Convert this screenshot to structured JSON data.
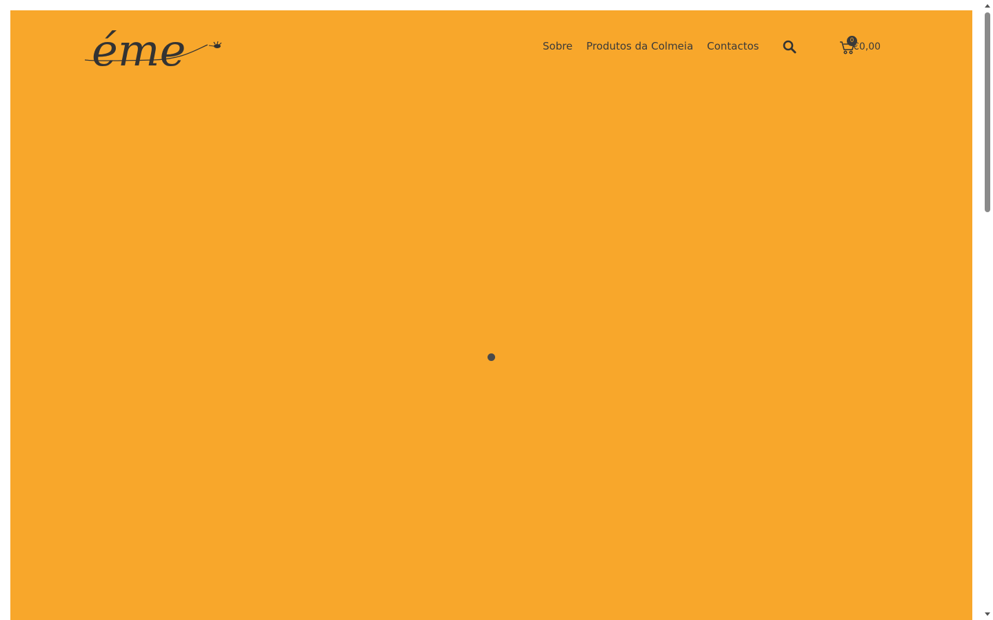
{
  "brand": {
    "logo_text": "éme",
    "logo_icon": "bee-icon",
    "ink_color": "#333333"
  },
  "nav": {
    "items": [
      {
        "label": "Sobre"
      },
      {
        "label": "Produtos da Colmeia"
      },
      {
        "label": "Contactos"
      }
    ]
  },
  "header": {
    "search_icon": "search-icon",
    "cart": {
      "icon": "cart-icon",
      "count": "0",
      "total": "€0,00"
    }
  },
  "theme": {
    "background": "#f8a72b",
    "text": "#3a3a3a"
  },
  "loader": {
    "icon": "loading-dot"
  }
}
